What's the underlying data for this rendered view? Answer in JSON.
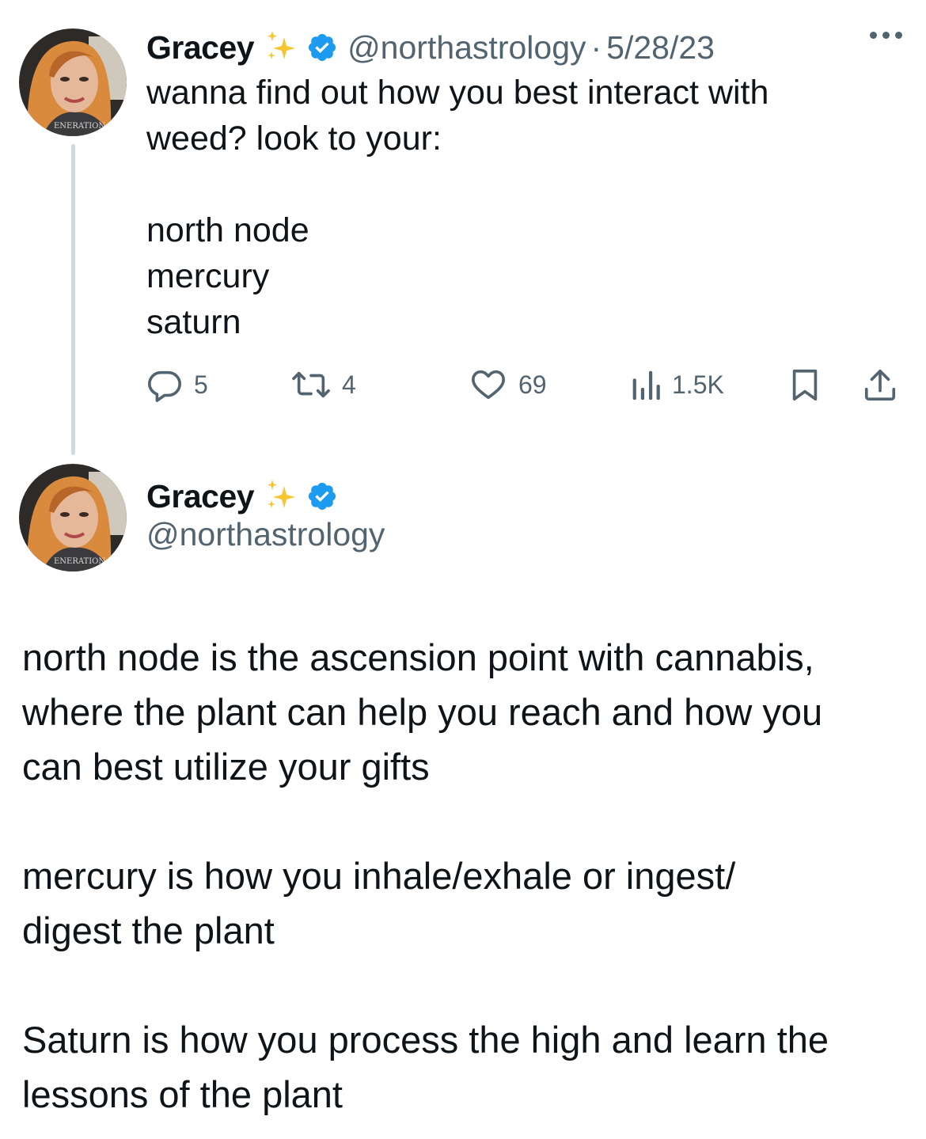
{
  "tweet1": {
    "author_name": "Gracey",
    "handle": "@northastrology",
    "separator": "·",
    "date": "5/28/23",
    "lines": [
      "wanna find out how you best interact with",
      "weed? look to your:",
      "",
      "north node",
      "mercury",
      "saturn"
    ],
    "actions": {
      "replies": "5",
      "reposts": "4",
      "likes": "69",
      "views": "1.5K"
    }
  },
  "tweet2": {
    "author_name": "Gracey",
    "handle": "@northastrology",
    "lines": [
      "north node is the ascension point with cannabis,",
      "where the plant can help you reach and how you",
      "can best utilize your gifts",
      "",
      "mercury is how you inhale/exhale or ingest/",
      "digest the plant",
      "",
      "Saturn is how you process the high and learn the",
      "lessons of the plant"
    ]
  },
  "colors": {
    "text": "#0f1419",
    "secondary": "#536471",
    "verified": "#1d9bf0",
    "sparkle": "#f4c430",
    "thread_line": "#cfd9de"
  },
  "icons": {
    "verified": "verified-badge-icon",
    "sparkle": "sparkles-emoji",
    "more": "more-horizontal-icon",
    "reply": "reply-icon",
    "repost": "repost-icon",
    "like": "heart-icon",
    "views": "views-chart-icon",
    "bookmark": "bookmark-icon",
    "share": "share-icon"
  }
}
